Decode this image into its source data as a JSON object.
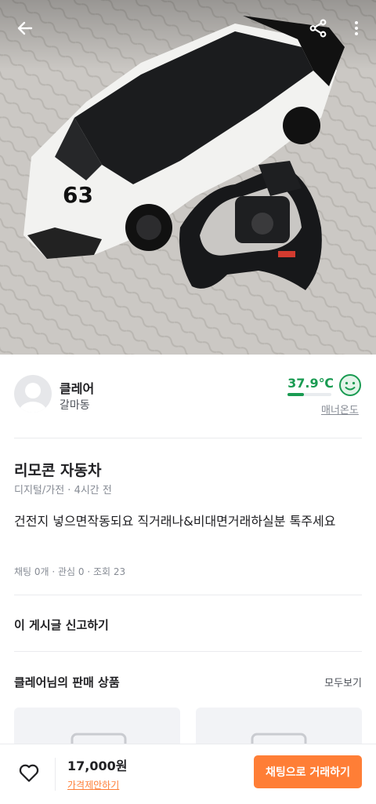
{
  "topbar": {
    "back_icon": "arrow-left-icon",
    "share_icon": "share-icon",
    "more_icon": "more-vertical-icon"
  },
  "seller": {
    "name": "클레어",
    "location": "갈마동",
    "temperature": "37.9℃",
    "temperature_level": 37.9,
    "manner_label": "매너온도"
  },
  "post": {
    "title": "리모콘 자동차",
    "category_time": "디지털/가전 · 4시간 전",
    "description": "건전지 넣으면작동되요 직거래나&비대면거래하실분 톡주세요",
    "counts": "채팅 0개 · 관심 0 · 조회 23"
  },
  "report_label": "이 게시글 신고하기",
  "sales": {
    "title": "클레어님의 판매 상품",
    "see_all": "모두보기"
  },
  "bottom": {
    "price": "17,000원",
    "negotiate": "가격제안하기",
    "chat_button": "채팅으로 거래하기"
  },
  "colors": {
    "accent": "#ff7e36",
    "temperature": "#1a9b52"
  }
}
